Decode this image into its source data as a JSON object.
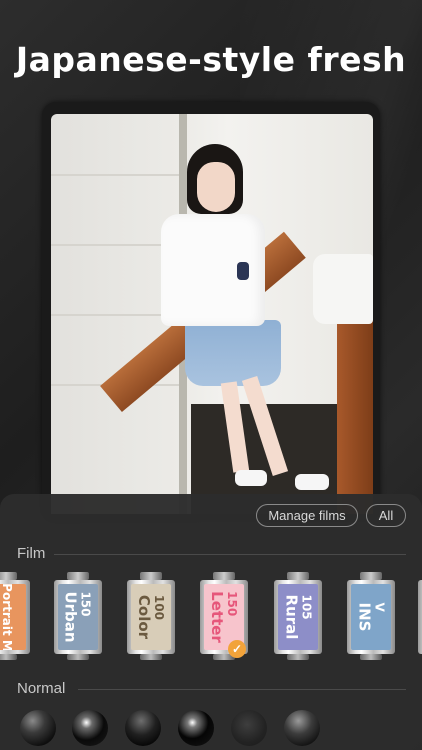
{
  "headline": "Japanese-style fresh",
  "panel": {
    "manage_films_label": "Manage films",
    "all_label": "All",
    "film_section_label": "Film",
    "normal_section_label": "Normal"
  },
  "films": [
    {
      "name": "Portrait M",
      "number": "",
      "label_color": "#e8955e",
      "text_color": "#ffffff"
    },
    {
      "name": "Urban",
      "number": "150",
      "label_color": "#8aa0b8",
      "text_color": "#ffffff"
    },
    {
      "name": "Color",
      "number": "100",
      "label_color": "#d8cdb8",
      "text_color": "#6b5a40"
    },
    {
      "name": "Letter",
      "number": "150",
      "label_color": "#f7c4cc",
      "text_color": "#e6567a",
      "selected": true
    },
    {
      "name": "Rural",
      "number": "105",
      "label_color": "#8d8ec8",
      "text_color": "#ffffff"
    },
    {
      "name": "INS",
      "number": "V",
      "label_color": "#7fa5c9",
      "text_color": "#ffffff"
    }
  ],
  "selected_check_icon": "✓",
  "accent_color": "#3ccfa6"
}
